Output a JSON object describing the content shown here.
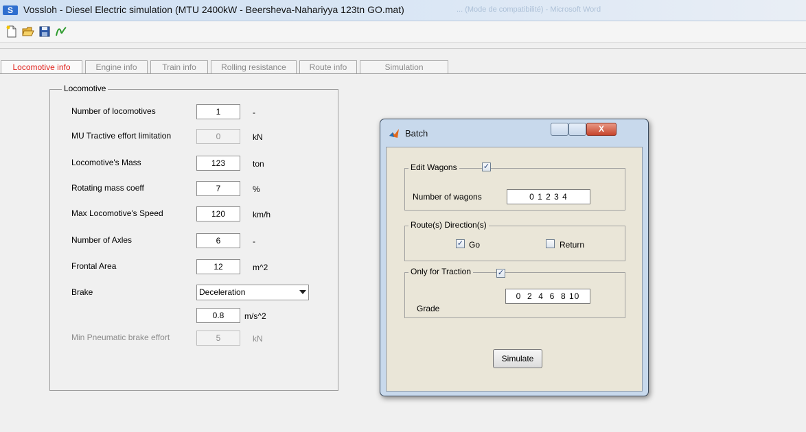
{
  "window": {
    "title": "Vossloh - Diesel Electric simulation (MTU 2400kW - Beersheva-Nahariyya 123tn GO.mat)",
    "ghost_title": "... (Mode de compatibilité) - Microsoft Word"
  },
  "toolbar": {
    "icons": [
      "new-file-icon",
      "open-folder-icon",
      "save-icon",
      "matlab-icon"
    ]
  },
  "tabs": [
    {
      "label": "Locomotive info",
      "active": true
    },
    {
      "label": "Engine info",
      "active": false
    },
    {
      "label": "Train info",
      "active": false
    },
    {
      "label": "Rolling resistance",
      "active": false
    },
    {
      "label": "Route info",
      "active": false
    },
    {
      "label": "Simulation",
      "active": false
    }
  ],
  "locomotive": {
    "group_title": "Locomotive",
    "rows": [
      {
        "label": "Number of locomotives",
        "value": "1",
        "unit": "-",
        "enabled": true
      },
      {
        "label": "MU Tractive effort limitation",
        "value": "0",
        "unit": "kN",
        "enabled": false
      },
      {
        "label": "Locomotive's Mass",
        "value": "123",
        "unit": "ton",
        "enabled": true
      },
      {
        "label": "Rotating mass coeff",
        "value": "7",
        "unit": "%",
        "enabled": true
      },
      {
        "label": "Max Locomotive's Speed",
        "value": "120",
        "unit": "km/h",
        "enabled": true
      },
      {
        "label": "Number of Axles",
        "value": "6",
        "unit": "-",
        "enabled": true
      },
      {
        "label": "Frontal Area",
        "value": "12",
        "unit": "m^2",
        "enabled": true
      }
    ],
    "brake": {
      "label": "Brake",
      "selected": "Deceleration",
      "value": "0.8",
      "unit": "m/s^2"
    },
    "pneumatic": {
      "label": "Min Pneumatic brake effort",
      "value": "5",
      "unit": "kN",
      "enabled": false
    }
  },
  "batch": {
    "title": "Batch",
    "close_label": "X",
    "edit_wagons": {
      "title": "Edit Wagons",
      "checked": true,
      "label": "Number of wagons",
      "value": "0 1 2 3 4"
    },
    "direction": {
      "title": "Route(s) Direction(s)",
      "go_label": "Go",
      "go_checked": true,
      "return_label": "Return",
      "return_checked": false
    },
    "traction": {
      "title": "Only for Traction",
      "checked": true,
      "label": "Grade",
      "value": "0  2  4  6  8 10"
    },
    "simulate_label": "Simulate",
    "check_glyph": "✓"
  },
  "colors": {
    "active_tab": "#e0201b",
    "app_icon": "#2f6fcf"
  }
}
